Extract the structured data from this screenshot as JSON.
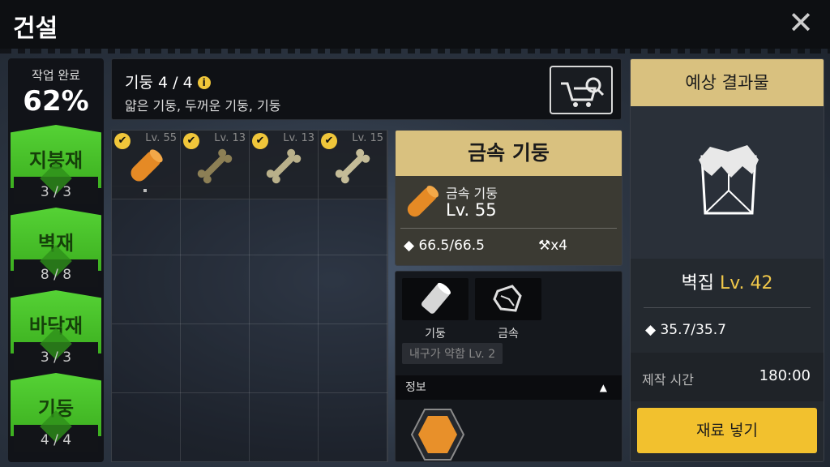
{
  "title": "건설",
  "sidebar": {
    "progress_label": "작업 완료",
    "progress_value": "62%",
    "categories": [
      {
        "name": "지붕재",
        "count": "3 / 3"
      },
      {
        "name": "벽재",
        "count": "8 / 8"
      },
      {
        "name": "바닥재",
        "count": "3 / 3"
      },
      {
        "name": "기둥",
        "count": "4 / 4"
      }
    ]
  },
  "header": {
    "title": "기둥 4 / 4",
    "info_glyph": "i",
    "subtitle": "얇은 기둥, 두꺼운 기둥, 기둥"
  },
  "inventory": {
    "slots": [
      {
        "level": "Lv. 55",
        "item": "orange-pillar",
        "color": "#e58a25",
        "checked": "✔"
      },
      {
        "level": "Lv. 13",
        "item": "bone",
        "color": "#8c7f55",
        "checked": "✔"
      },
      {
        "level": "Lv. 13",
        "item": "bone",
        "color": "#b9b08a",
        "checked": "✔"
      },
      {
        "level": "Lv. 15",
        "item": "bone",
        "color": "#c4bc98",
        "checked": "✔"
      }
    ]
  },
  "detail": {
    "title": "금속 기둥",
    "name": "금속 기둥",
    "level": "Lv. 55",
    "durability": "66.5/66.5",
    "hammer_count": "x4"
  },
  "materials": {
    "items": [
      {
        "label": "기둥",
        "icon": "pillar-icon"
      },
      {
        "label": "금속",
        "icon": "metal-icon"
      }
    ],
    "weak_tag": "내구가 약함 Lv. 2",
    "info_label": "정보",
    "info_arrow": "▲"
  },
  "result": {
    "header": "예상 결과물",
    "name": "벽집",
    "level": "Lv. 42",
    "durability": "35.7/35.7",
    "time_label": "제작 시간",
    "time_value": "180:00",
    "button": "재료 넣기"
  },
  "colors": {
    "accent_green": "#4fc92c",
    "accent_gold": "#d9c17f",
    "button_yellow": "#f2c12e",
    "level_yellow": "#f1c84a"
  }
}
